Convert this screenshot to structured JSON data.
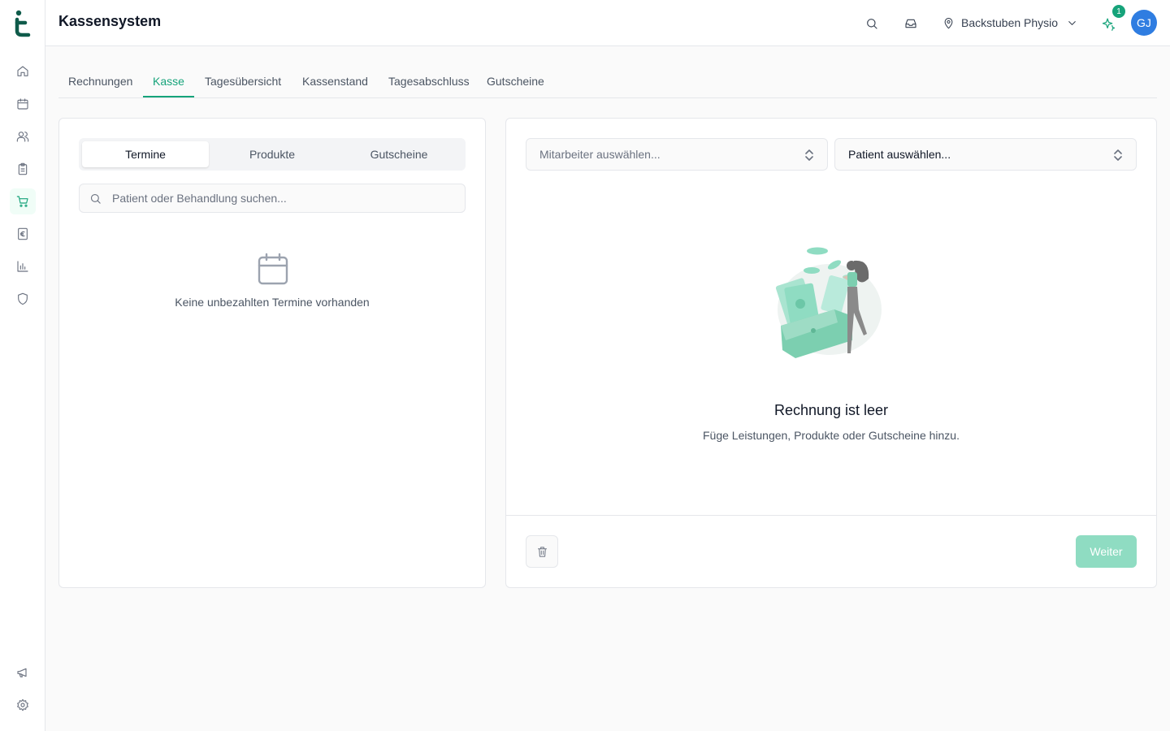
{
  "app": {
    "title": "Kassensystem"
  },
  "header": {
    "location": "Backstuben Physio",
    "notification_count": "1",
    "avatar_initials": "GJ"
  },
  "sidebar": {
    "items": [
      {
        "name": "home-icon"
      },
      {
        "name": "calendar-icon"
      },
      {
        "name": "users-icon"
      },
      {
        "name": "clipboard-icon"
      },
      {
        "name": "cart-icon",
        "active": true
      },
      {
        "name": "euro-icon"
      },
      {
        "name": "chart-icon"
      },
      {
        "name": "shield-icon"
      }
    ],
    "bottom": [
      {
        "name": "megaphone-icon"
      },
      {
        "name": "gear-icon"
      }
    ]
  },
  "tabs": [
    {
      "label": "Rechnungen"
    },
    {
      "label": "Kasse",
      "active": true
    },
    {
      "label": "Tagesübersicht"
    },
    {
      "label": "Kassenstand"
    },
    {
      "label": "Tagesabschluss"
    },
    {
      "label": "Gutscheine"
    }
  ],
  "left_panel": {
    "segments": [
      {
        "label": "Termine",
        "active": true
      },
      {
        "label": "Produkte"
      },
      {
        "label": "Gutscheine"
      }
    ],
    "search_placeholder": "Patient oder Behandlung suchen...",
    "empty_text": "Keine unbezahlten Termine vorhanden"
  },
  "right_panel": {
    "employee_select": "Mitarbeiter auswählen...",
    "patient_select": "Patient auswählen...",
    "empty_title": "Rechnung ist leer",
    "empty_subtitle": "Füge Leistungen, Produkte oder Gutscheine hinzu.",
    "next_button": "Weiter"
  },
  "colors": {
    "accent": "#16a37a",
    "accent_light": "#8fdcc2",
    "avatar": "#2f7de1"
  }
}
